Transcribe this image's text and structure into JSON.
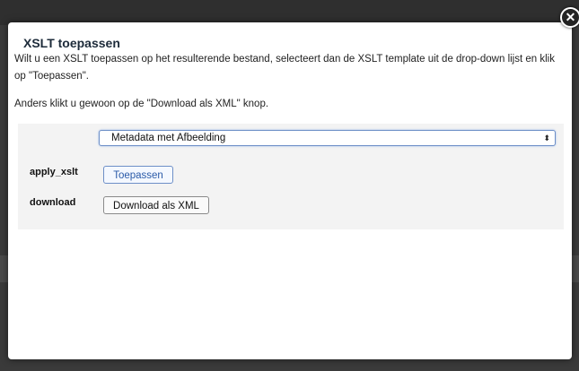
{
  "dialog": {
    "title": "XSLT toepassen",
    "intro": "Wilt u een XSLT toepassen op het resulterende bestand, selecteert dan de XSLT template uit de drop-down lijst en klik op \"Toepassen\".",
    "intro2": "Anders klikt u gewoon op de \"Download als XML\" knop.",
    "close_icon": "✕"
  },
  "form": {
    "template_select_value": "Metadata met Afbeelding",
    "select_arrow": "⬍",
    "apply_label": "apply_xslt",
    "apply_button": "Toepassen",
    "download_label": "download",
    "download_button": "Download als XML"
  }
}
